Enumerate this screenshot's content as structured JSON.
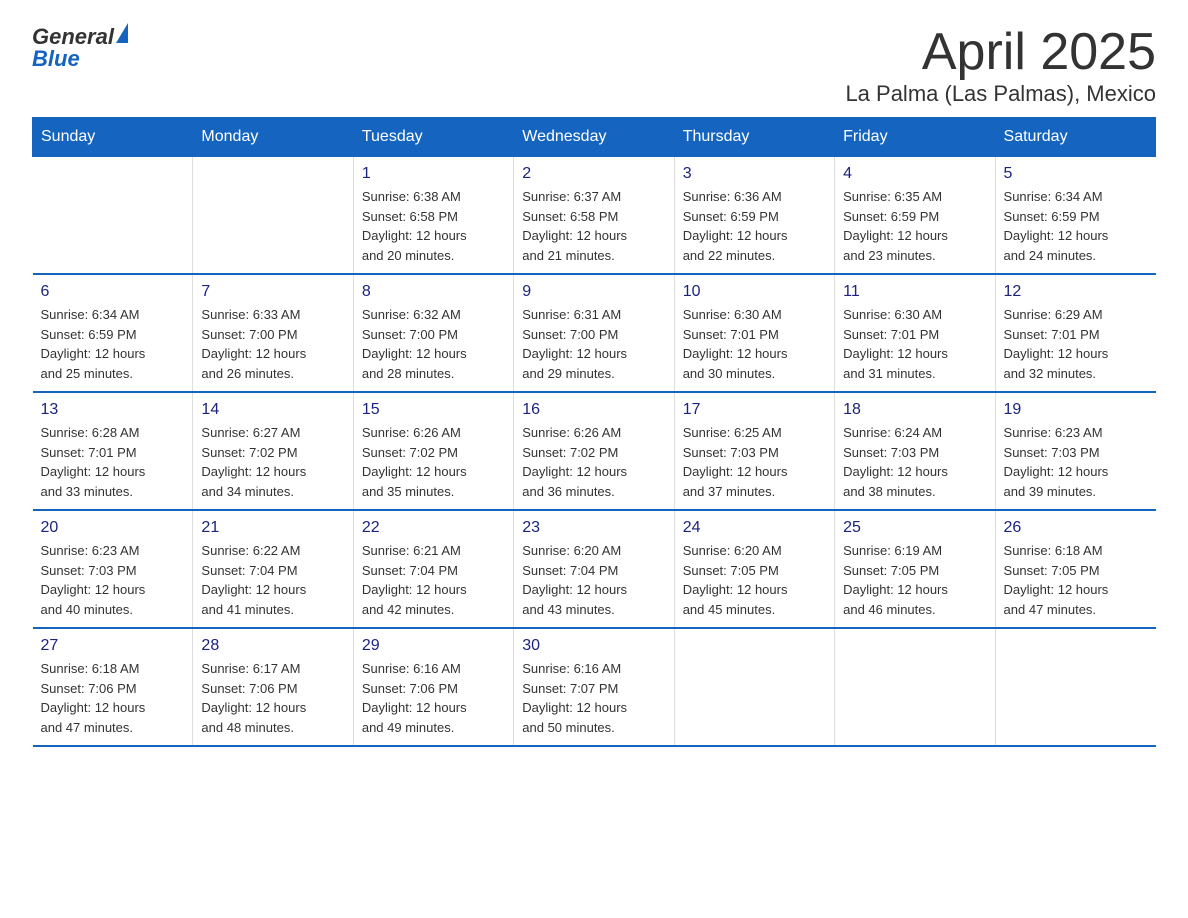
{
  "header": {
    "logo_general": "General",
    "logo_blue": "Blue",
    "title": "April 2025",
    "subtitle": "La Palma (Las Palmas), Mexico"
  },
  "weekdays": [
    "Sunday",
    "Monday",
    "Tuesday",
    "Wednesday",
    "Thursday",
    "Friday",
    "Saturday"
  ],
  "weeks": [
    [
      {
        "day": "",
        "info": ""
      },
      {
        "day": "",
        "info": ""
      },
      {
        "day": "1",
        "info": "Sunrise: 6:38 AM\nSunset: 6:58 PM\nDaylight: 12 hours\nand 20 minutes."
      },
      {
        "day": "2",
        "info": "Sunrise: 6:37 AM\nSunset: 6:58 PM\nDaylight: 12 hours\nand 21 minutes."
      },
      {
        "day": "3",
        "info": "Sunrise: 6:36 AM\nSunset: 6:59 PM\nDaylight: 12 hours\nand 22 minutes."
      },
      {
        "day": "4",
        "info": "Sunrise: 6:35 AM\nSunset: 6:59 PM\nDaylight: 12 hours\nand 23 minutes."
      },
      {
        "day": "5",
        "info": "Sunrise: 6:34 AM\nSunset: 6:59 PM\nDaylight: 12 hours\nand 24 minutes."
      }
    ],
    [
      {
        "day": "6",
        "info": "Sunrise: 6:34 AM\nSunset: 6:59 PM\nDaylight: 12 hours\nand 25 minutes."
      },
      {
        "day": "7",
        "info": "Sunrise: 6:33 AM\nSunset: 7:00 PM\nDaylight: 12 hours\nand 26 minutes."
      },
      {
        "day": "8",
        "info": "Sunrise: 6:32 AM\nSunset: 7:00 PM\nDaylight: 12 hours\nand 28 minutes."
      },
      {
        "day": "9",
        "info": "Sunrise: 6:31 AM\nSunset: 7:00 PM\nDaylight: 12 hours\nand 29 minutes."
      },
      {
        "day": "10",
        "info": "Sunrise: 6:30 AM\nSunset: 7:01 PM\nDaylight: 12 hours\nand 30 minutes."
      },
      {
        "day": "11",
        "info": "Sunrise: 6:30 AM\nSunset: 7:01 PM\nDaylight: 12 hours\nand 31 minutes."
      },
      {
        "day": "12",
        "info": "Sunrise: 6:29 AM\nSunset: 7:01 PM\nDaylight: 12 hours\nand 32 minutes."
      }
    ],
    [
      {
        "day": "13",
        "info": "Sunrise: 6:28 AM\nSunset: 7:01 PM\nDaylight: 12 hours\nand 33 minutes."
      },
      {
        "day": "14",
        "info": "Sunrise: 6:27 AM\nSunset: 7:02 PM\nDaylight: 12 hours\nand 34 minutes."
      },
      {
        "day": "15",
        "info": "Sunrise: 6:26 AM\nSunset: 7:02 PM\nDaylight: 12 hours\nand 35 minutes."
      },
      {
        "day": "16",
        "info": "Sunrise: 6:26 AM\nSunset: 7:02 PM\nDaylight: 12 hours\nand 36 minutes."
      },
      {
        "day": "17",
        "info": "Sunrise: 6:25 AM\nSunset: 7:03 PM\nDaylight: 12 hours\nand 37 minutes."
      },
      {
        "day": "18",
        "info": "Sunrise: 6:24 AM\nSunset: 7:03 PM\nDaylight: 12 hours\nand 38 minutes."
      },
      {
        "day": "19",
        "info": "Sunrise: 6:23 AM\nSunset: 7:03 PM\nDaylight: 12 hours\nand 39 minutes."
      }
    ],
    [
      {
        "day": "20",
        "info": "Sunrise: 6:23 AM\nSunset: 7:03 PM\nDaylight: 12 hours\nand 40 minutes."
      },
      {
        "day": "21",
        "info": "Sunrise: 6:22 AM\nSunset: 7:04 PM\nDaylight: 12 hours\nand 41 minutes."
      },
      {
        "day": "22",
        "info": "Sunrise: 6:21 AM\nSunset: 7:04 PM\nDaylight: 12 hours\nand 42 minutes."
      },
      {
        "day": "23",
        "info": "Sunrise: 6:20 AM\nSunset: 7:04 PM\nDaylight: 12 hours\nand 43 minutes."
      },
      {
        "day": "24",
        "info": "Sunrise: 6:20 AM\nSunset: 7:05 PM\nDaylight: 12 hours\nand 45 minutes."
      },
      {
        "day": "25",
        "info": "Sunrise: 6:19 AM\nSunset: 7:05 PM\nDaylight: 12 hours\nand 46 minutes."
      },
      {
        "day": "26",
        "info": "Sunrise: 6:18 AM\nSunset: 7:05 PM\nDaylight: 12 hours\nand 47 minutes."
      }
    ],
    [
      {
        "day": "27",
        "info": "Sunrise: 6:18 AM\nSunset: 7:06 PM\nDaylight: 12 hours\nand 47 minutes."
      },
      {
        "day": "28",
        "info": "Sunrise: 6:17 AM\nSunset: 7:06 PM\nDaylight: 12 hours\nand 48 minutes."
      },
      {
        "day": "29",
        "info": "Sunrise: 6:16 AM\nSunset: 7:06 PM\nDaylight: 12 hours\nand 49 minutes."
      },
      {
        "day": "30",
        "info": "Sunrise: 6:16 AM\nSunset: 7:07 PM\nDaylight: 12 hours\nand 50 minutes."
      },
      {
        "day": "",
        "info": ""
      },
      {
        "day": "",
        "info": ""
      },
      {
        "day": "",
        "info": ""
      }
    ]
  ]
}
